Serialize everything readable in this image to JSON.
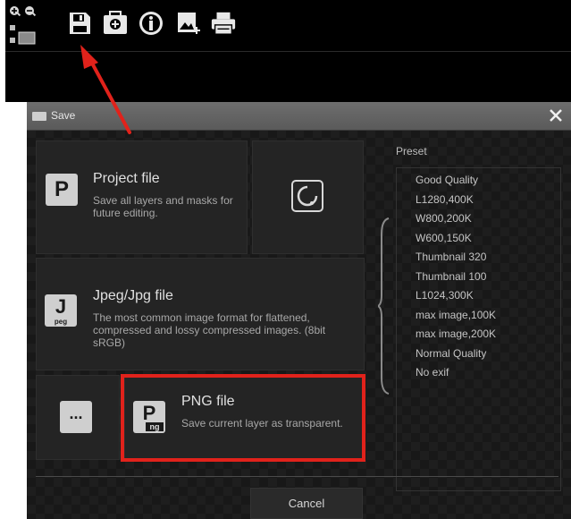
{
  "toolbar": {
    "buttons": [
      {
        "name": "zoom-in-icon"
      },
      {
        "name": "zoom-out-icon"
      },
      {
        "name": "fit-view-icon"
      },
      {
        "name": "save-icon"
      },
      {
        "name": "add-folder-icon"
      },
      {
        "name": "info-icon"
      },
      {
        "name": "export-image-icon"
      },
      {
        "name": "print-icon"
      }
    ]
  },
  "dialog": {
    "title": "Save",
    "close_glyph": "×"
  },
  "options": {
    "project": {
      "title": "Project file",
      "desc": "Save all layers and masks for future editing.",
      "icon_text": "P"
    },
    "jpeg": {
      "title": "Jpeg/Jpg file",
      "desc": "The most common image format for flattened, compressed and lossy compressed images. (8bit sRGB)",
      "icon_text": "J",
      "icon_sub": "peg"
    },
    "png": {
      "title": "PNG file",
      "desc": "Save current layer as transparent.",
      "icon_text": "P",
      "icon_sub": "ng"
    },
    "more": {
      "icon_text": "..."
    }
  },
  "preset": {
    "label": "Preset",
    "items": [
      "Good Quality",
      "L1280,400K",
      "W800,200K",
      "W600,150K",
      "Thumbnail 320",
      "Thumbnail 100",
      "L1024,300K",
      "max image,100K",
      "max image,200K",
      "Normal Quality",
      "No exif"
    ]
  },
  "footer": {
    "cancel_label": "Cancel"
  },
  "colors": {
    "highlight": "#e1221b",
    "background": "#000000",
    "dialog": "#181818"
  }
}
